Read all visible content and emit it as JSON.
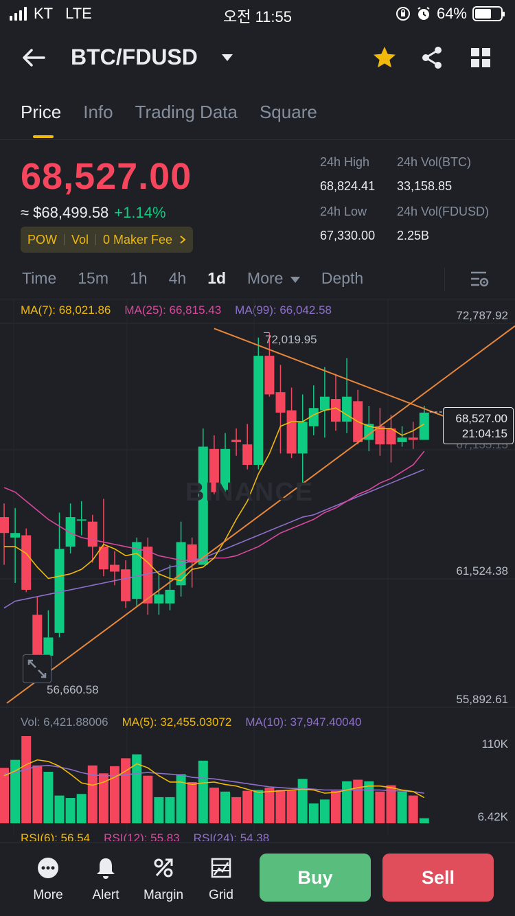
{
  "status_bar": {
    "carrier": "KT",
    "network": "LTE",
    "time": "오전 11:55",
    "battery_text": "64%",
    "battery_level": 0.64
  },
  "header": {
    "title": "BTC/FDUSD"
  },
  "tabs": [
    {
      "label": "Price",
      "active": true
    },
    {
      "label": "Info"
    },
    {
      "label": "Trading Data"
    },
    {
      "label": "Square"
    }
  ],
  "price": {
    "last": "68,527.00",
    "usd": "≈ $68,499.58",
    "change": "+1.14%"
  },
  "tags": [
    "POW",
    "Vol",
    "0 Maker Fee"
  ],
  "stats": {
    "high_label": "24h High",
    "high": "68,824.41",
    "vol_btc_label": "24h Vol(BTC)",
    "vol_btc": "33,158.85",
    "low_label": "24h Low",
    "low": "67,330.00",
    "vol_fdusd_label": "24h Vol(FDUSD)",
    "vol_fdusd": "2.25B"
  },
  "timeframes": [
    "Time",
    "15m",
    "1h",
    "4h",
    "1d",
    "More",
    "Depth"
  ],
  "active_timeframe": "1d",
  "indicators": {
    "ma7": "MA(7): 68,021.86",
    "ma25": "MA(25): 66,815.43",
    "ma99": "MA(99): 66,042.58",
    "vol": "Vol: 6,421.88006",
    "vol_ma5": "MA(5): 32,455.03072",
    "vol_ma10": "MA(10): 37,947.40040",
    "rsi6": "RSI(6): 56.54",
    "rsi12": "RSI(12): 55.83",
    "rsi24": "RSI(24): 54.38"
  },
  "axis": {
    "p1": "72,787.92",
    "p2": "67,155.15",
    "p3": "61,524.38",
    "p4": "55,892.61",
    "v1": "110K",
    "v2": "6.42K",
    "high_marker": "72,019.95",
    "low_marker": "56,660.58"
  },
  "current_price_box": {
    "price": "68,527.00",
    "countdown": "21:04:15"
  },
  "watermark": "BINANCE",
  "bottom_nav": [
    {
      "label": "More",
      "icon": "more-icon"
    },
    {
      "label": "Alert",
      "icon": "bell-icon"
    },
    {
      "label": "Margin",
      "icon": "margin-icon"
    },
    {
      "label": "Grid",
      "icon": "grid-icon"
    }
  ],
  "buy_label": "Buy",
  "sell_label": "Sell",
  "colors": {
    "up": "#0ecb81",
    "down": "#f6465d",
    "accent": "#f0b90b",
    "ma7": "#f0b90b",
    "ma25": "#d9489d",
    "ma99": "#8e6fc9",
    "trend": "#e8873a"
  },
  "chart_data": {
    "type": "candlestick",
    "y_range": [
      55892.61,
      72787.92
    ],
    "candles": [
      {
        "o": 63900,
        "c": 63200,
        "h": 64500,
        "l": 61800
      },
      {
        "o": 63000,
        "c": 63200,
        "h": 64300,
        "l": 61000
      },
      {
        "o": 63100,
        "c": 60700,
        "h": 63400,
        "l": 60600
      },
      {
        "o": 59600,
        "c": 57500,
        "h": 60400,
        "l": 57000
      },
      {
        "o": 57800,
        "c": 58600,
        "h": 59800,
        "l": 57000
      },
      {
        "o": 58800,
        "c": 62500,
        "h": 64100,
        "l": 58600
      },
      {
        "o": 62600,
        "c": 63900,
        "h": 64500,
        "l": 62300
      },
      {
        "o": 63800,
        "c": 63800,
        "h": 64600,
        "l": 63100
      },
      {
        "o": 63700,
        "c": 62600,
        "h": 64000,
        "l": 61900
      },
      {
        "o": 62600,
        "c": 61600,
        "h": 64700,
        "l": 61300
      },
      {
        "o": 61800,
        "c": 61500,
        "h": 62400,
        "l": 60900
      },
      {
        "o": 61600,
        "c": 60200,
        "h": 62000,
        "l": 59900
      },
      {
        "o": 60300,
        "c": 62800,
        "h": 63000,
        "l": 60000
      },
      {
        "o": 62600,
        "c": 60100,
        "h": 63000,
        "l": 59600
      },
      {
        "o": 60100,
        "c": 60500,
        "h": 61400,
        "l": 59600
      },
      {
        "o": 60100,
        "c": 60700,
        "h": 61800,
        "l": 59800
      },
      {
        "o": 60900,
        "c": 62800,
        "h": 63700,
        "l": 60400
      },
      {
        "o": 62700,
        "c": 61900,
        "h": 63000,
        "l": 60800
      },
      {
        "o": 61800,
        "c": 67000,
        "h": 67800,
        "l": 61800
      },
      {
        "o": 66900,
        "c": 65000,
        "h": 67500,
        "l": 64900
      },
      {
        "o": 65100,
        "c": 66900,
        "h": 67600,
        "l": 64900
      },
      {
        "o": 67300,
        "c": 67200,
        "h": 67800,
        "l": 66600
      },
      {
        "o": 67100,
        "c": 66200,
        "h": 68000,
        "l": 66000
      },
      {
        "o": 66200,
        "c": 71000,
        "h": 71800,
        "l": 66000
      },
      {
        "o": 71000,
        "c": 69300,
        "h": 72020,
        "l": 69200
      },
      {
        "o": 69400,
        "c": 68500,
        "h": 70600,
        "l": 66700
      },
      {
        "o": 68600,
        "c": 66700,
        "h": 69600,
        "l": 66500
      },
      {
        "o": 66700,
        "c": 68100,
        "h": 69300,
        "l": 65400
      },
      {
        "o": 67900,
        "c": 68700,
        "h": 69700,
        "l": 67500
      },
      {
        "o": 68600,
        "c": 69200,
        "h": 70500,
        "l": 67400
      },
      {
        "o": 69100,
        "c": 68100,
        "h": 70200,
        "l": 67700
      },
      {
        "o": 68100,
        "c": 69200,
        "h": 70900,
        "l": 67600
      },
      {
        "o": 69000,
        "c": 67200,
        "h": 69500,
        "l": 67100
      },
      {
        "o": 67300,
        "c": 68000,
        "h": 68800,
        "l": 66800
      },
      {
        "o": 67900,
        "c": 67100,
        "h": 68700,
        "l": 66600
      },
      {
        "o": 67800,
        "c": 67100,
        "h": 68400,
        "l": 66300
      },
      {
        "o": 67200,
        "c": 67400,
        "h": 67900,
        "l": 67000
      },
      {
        "o": 67400,
        "c": 67300,
        "h": 68100,
        "l": 66900
      },
      {
        "o": 67300,
        "c": 68500,
        "h": 68800,
        "l": 67300
      }
    ],
    "ma7": [
      62600,
      62600,
      62300,
      61700,
      61200,
      61300,
      61400,
      61600,
      62000,
      62700,
      62500,
      62200,
      62300,
      61900,
      61400,
      61200,
      61100,
      61600,
      61700,
      62100,
      62900,
      63800,
      64600,
      65800,
      66700,
      67900,
      68100,
      68100,
      68400,
      68600,
      68700,
      68400,
      68100,
      67900,
      67800,
      67800,
      67500,
      67700,
      68000
    ],
    "ma25": [
      65200,
      65000,
      64600,
      64200,
      63800,
      63500,
      63200,
      63000,
      62900,
      62800,
      62700,
      62600,
      62500,
      62400,
      62200,
      62100,
      62000,
      62000,
      62000,
      62100,
      62100,
      62200,
      62400,
      62600,
      62900,
      63200,
      63400,
      63600,
      63800,
      64100,
      64300,
      64600,
      64900,
      65100,
      65400,
      65600,
      65900,
      66200,
      66800
    ],
    "ma99": [
      59900,
      60200,
      60300,
      60400,
      60500,
      60600,
      60700,
      60800,
      60900,
      61000,
      61100,
      61200,
      61300,
      61400,
      61500,
      61700,
      61800,
      62000,
      62100,
      62300,
      62500,
      62700,
      62900,
      63100,
      63300,
      63500,
      63700,
      63900,
      64000,
      64200,
      64400,
      64600,
      64800,
      65000,
      65200,
      65400,
      65600,
      65800,
      66000
    ],
    "volume_max": 110000,
    "volumes": [
      70000,
      80000,
      110000,
      73000,
      65000,
      35000,
      32000,
      37000,
      73000,
      63000,
      72000,
      82000,
      87000,
      60000,
      33000,
      33000,
      62000,
      52000,
      79000,
      45000,
      40000,
      33000,
      41000,
      42000,
      45000,
      42000,
      42000,
      56000,
      25000,
      30000,
      41000,
      53000,
      55000,
      53000,
      40000,
      48000,
      40000,
      35000,
      6420
    ],
    "vol_ma5": [
      60000,
      66000,
      74000,
      80000,
      78000,
      72000,
      62000,
      51000,
      48000,
      52000,
      58000,
      66000,
      75000,
      70000,
      60000,
      52000,
      52000,
      49000,
      51000,
      52000,
      49000,
      47000,
      43000,
      39000,
      40000,
      41000,
      42000,
      43000,
      42000,
      38000,
      39000,
      42000,
      45000,
      47000,
      47000,
      45000,
      42000,
      40000,
      32455
    ],
    "vol_ma10": [
      62000,
      64000,
      68000,
      72000,
      73000,
      71000,
      68000,
      64000,
      61000,
      60000,
      60000,
      61000,
      63000,
      64000,
      63000,
      62000,
      61000,
      58000,
      57000,
      56000,
      54000,
      52000,
      50000,
      48000,
      46000,
      45000,
      44000,
      44000,
      43000,
      42000,
      42000,
      42000,
      42000,
      42000,
      42000,
      41000,
      41000,
      40000,
      37947
    ],
    "trendlines": [
      {
        "from": [
          "first",
          55892.61
        ],
        "to": [
          "beyond-last",
          70500
        ],
        "label": "support"
      },
      {
        "from": [
          24,
          72200
        ],
        "to": [
          "beyond-last",
          68300
        ],
        "label": "resistance"
      }
    ],
    "x_labels": [],
    "grid": true
  }
}
